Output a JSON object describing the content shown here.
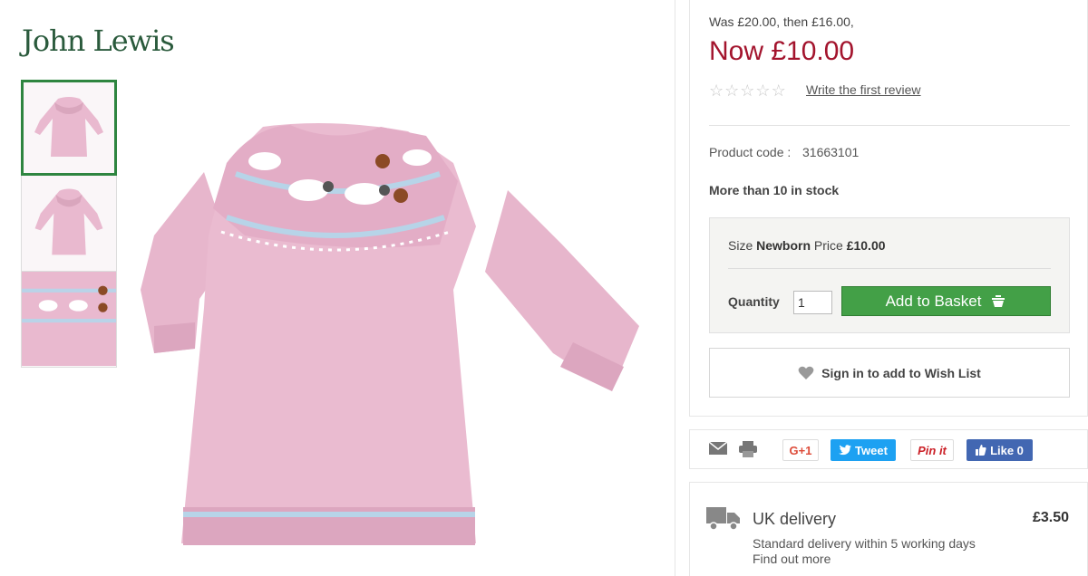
{
  "brand": {
    "logo_text": "John Lewis"
  },
  "gallery": {
    "thumbnails": [
      "dress-front",
      "dress-alt",
      "yoke-detail"
    ],
    "selected_index": 0
  },
  "price": {
    "was_text": "Was  £20.00, then  £16.00,",
    "now_text": "Now  £10.00"
  },
  "reviews": {
    "rating": 0,
    "max": 5,
    "link_text": "Write the first review"
  },
  "product": {
    "code_label": "Product code :",
    "code_value": "31663101",
    "stock_text": "More than 10 in stock"
  },
  "buybox": {
    "size_label": "Size",
    "size_value": "Newborn",
    "price_label": "Price",
    "price_value": "£10.00",
    "quantity_label": "Quantity",
    "quantity_value": "1",
    "add_button_label": "Add to Basket"
  },
  "wishlist": {
    "label": "Sign in to add to Wish List"
  },
  "share": {
    "gplus_label": "G+1",
    "tweet_label": "Tweet",
    "pin_label": "Pin it",
    "like_label": "Like 0"
  },
  "delivery": {
    "title": "UK delivery",
    "price": "£3.50",
    "subtitle": "Standard delivery within 5 working days",
    "link_text": "Find out more"
  },
  "colors": {
    "price_now": "#a3142d",
    "basket_green": "#43a047",
    "logo_green": "#2a5a3c",
    "dress_pink": "#e9b9cf"
  }
}
